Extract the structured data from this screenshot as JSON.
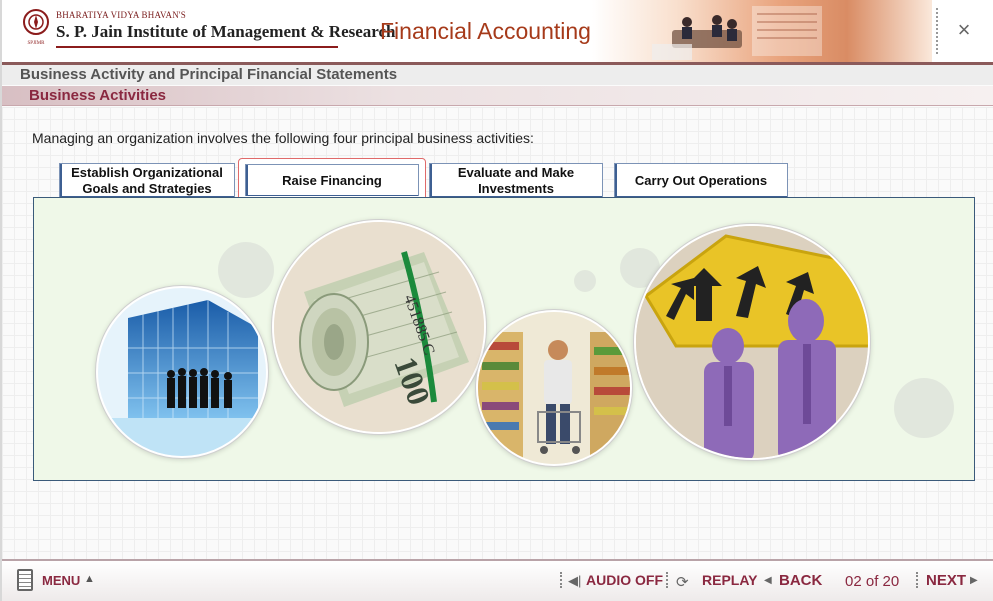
{
  "header": {
    "logo_line1": "BHARATIYA VIDYA BHAVAN'S",
    "logo_line2": "S. P. Jain Institute of Management & Research",
    "seal_text": "SPJIMR",
    "course_title": "Financial Accounting",
    "close_label": "×"
  },
  "breadcrumb": {
    "module": "Business Activity and Principal Financial Statements",
    "section": "Business Activities"
  },
  "content": {
    "intro": "Managing an organization involves the following four principal business activities:",
    "tabs": [
      {
        "label": "Establish Organizational Goals and Strategies",
        "active": false
      },
      {
        "label": "Raise Financing",
        "active": true
      },
      {
        "label": "Evaluate and Make Investments",
        "active": false
      },
      {
        "label": "Carry Out Operations",
        "active": false
      }
    ],
    "images": [
      "business-team-image",
      "money-roll-image",
      "supermarket-shopper-image",
      "direction-sign-image"
    ]
  },
  "footer": {
    "menu_label": "MENU",
    "audio_label": "AUDIO OFF",
    "replay_label": "REPLAY",
    "back_label": "BACK",
    "page_indicator": "02 of 20",
    "next_label": "NEXT"
  },
  "colors": {
    "brand_maroon": "#8a2840",
    "title_orange": "#a63a1a",
    "panel_green": "#eff8e8",
    "tab_border": "#7c93b6",
    "active_tab_border": "#e06a6a"
  }
}
